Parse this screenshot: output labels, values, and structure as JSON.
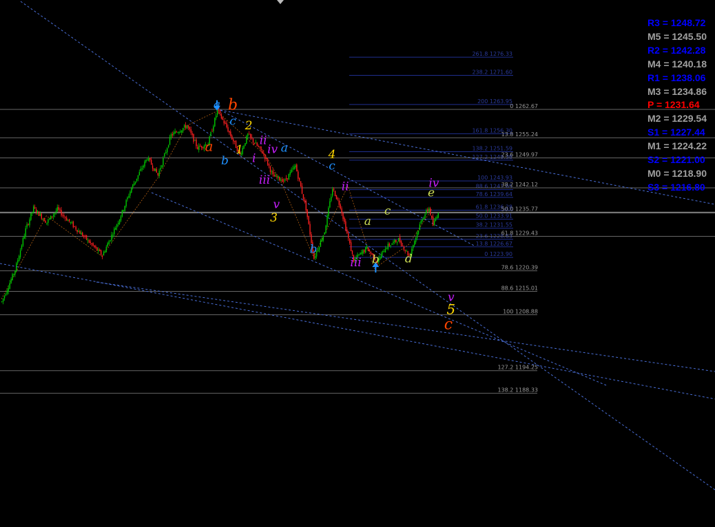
{
  "chart_data": {
    "type": "candlestick",
    "title": "",
    "price_range": [
      1180.0,
      1280.0
    ],
    "colors": {
      "bull": "#00c800",
      "bear": "#ff2020",
      "grid": "#8a8a8a",
      "trend": "#4a6fd8",
      "fib": "#1f2f8f"
    },
    "pivots": [
      {
        "label": "R3 = 1248.72",
        "color": "#0000ff"
      },
      {
        "label": "M5 = 1245.50",
        "color": "#a0a0a0"
      },
      {
        "label": "R2 = 1242.28",
        "color": "#0000ff"
      },
      {
        "label": "M4 = 1240.18",
        "color": "#a0a0a0"
      },
      {
        "label": "R1 = 1238.06",
        "color": "#0000ff"
      },
      {
        "label": "M3 = 1234.86",
        "color": "#a0a0a0"
      },
      {
        "label": "P   = 1231.64",
        "color": "#ff0000"
      },
      {
        "label": "M2 = 1229.54",
        "color": "#a0a0a0"
      },
      {
        "label": "S1 = 1227.44",
        "color": "#0000ff"
      },
      {
        "label": "M1 = 1224.22",
        "color": "#a0a0a0"
      },
      {
        "label": "S2 = 1221.00",
        "color": "#0000ff"
      },
      {
        "label": "M0 = 1218.90",
        "color": "#a0a0a0"
      },
      {
        "label": "S3 = 1216.80",
        "color": "#0000ff"
      }
    ],
    "fib_upper": [
      {
        "label": "261.8 1276.33",
        "price": 1276.33
      },
      {
        "label": "238.2 1271.60",
        "price": 1271.6
      },
      {
        "label": "200 1263.95",
        "price": 1263.95
      },
      {
        "label": "161.8 1256.30",
        "price": 1256.3
      },
      {
        "label": "138.2 1251.59",
        "price": 1251.59
      },
      {
        "label": "127.2 1249.38",
        "price": 1249.38
      },
      {
        "label": "100 1243.93",
        "price": 1243.93
      },
      {
        "label": "88.6 1241.65",
        "price": 1241.65
      },
      {
        "label": "78.6 1239.64",
        "price": 1239.64
      },
      {
        "label": "61.8 1236.28",
        "price": 1236.28
      },
      {
        "label": "50.0 1233.91",
        "price": 1233.91
      },
      {
        "label": "38.2 1231.55",
        "price": 1231.55
      },
      {
        "label": "23.6 1228.63",
        "price": 1228.63
      },
      {
        "label": "13.8 1226.67",
        "price": 1226.67
      },
      {
        "label": "0 1223.90",
        "price": 1223.9
      }
    ],
    "fib_lower": [
      {
        "label": "0 1262.67",
        "price": 1262.67
      },
      {
        "label": "13.8 1255.24",
        "price": 1255.24
      },
      {
        "label": "23.6 1249.97",
        "price": 1249.97
      },
      {
        "label": "38.2 1242.12",
        "price": 1242.12
      },
      {
        "label": "50.0 1235.77",
        "price": 1235.77
      },
      {
        "label": "61.8 1229.43",
        "price": 1229.43
      },
      {
        "label": "78.6 1220.39",
        "price": 1220.39
      },
      {
        "label": "88.6 1215.01",
        "price": 1215.01
      },
      {
        "label": "100 1208.88",
        "price": 1208.88
      },
      {
        "label": "127.2 1194.25",
        "price": 1194.25
      },
      {
        "label": "138.2 1188.33",
        "price": 1188.33
      }
    ],
    "current_price": 1235.6,
    "wave_labels": [
      {
        "text": "a",
        "color": "#1e90ff",
        "bar": 163,
        "price": 1262.9
      },
      {
        "text": "b",
        "color": "#ff4500",
        "bar": 175,
        "price": 1262.6,
        "size": 22
      },
      {
        "text": "c",
        "color": "#1e90ff",
        "bar": 175,
        "price": 1258.6
      },
      {
        "text": "2",
        "color": "#ffd700",
        "bar": 187,
        "price": 1257.4
      },
      {
        "text": "a",
        "color": "#ff4500",
        "bar": 157,
        "price": 1251.8,
        "size": 20
      },
      {
        "text": "1",
        "color": "#ffd700",
        "bar": 180,
        "price": 1251.1
      },
      {
        "text": "ii",
        "color": "#c81eff",
        "bar": 198,
        "price": 1253.6
      },
      {
        "text": "iv",
        "color": "#c81eff",
        "bar": 205,
        "price": 1251.2
      },
      {
        "text": "a",
        "color": "#1e90ff",
        "bar": 214,
        "price": 1251.6
      },
      {
        "text": "b",
        "color": "#1e90ff",
        "bar": 169,
        "price": 1248.3
      },
      {
        "text": "i",
        "color": "#c81eff",
        "bar": 191,
        "price": 1248.9
      },
      {
        "text": "iii",
        "color": "#c81eff",
        "bar": 199,
        "price": 1243.2
      },
      {
        "text": "4",
        "color": "#ffd700",
        "bar": 250,
        "price": 1249.9
      },
      {
        "text": "c",
        "color": "#1e90ff",
        "bar": 250,
        "price": 1246.9
      },
      {
        "text": "ii",
        "color": "#c81eff",
        "bar": 260,
        "price": 1241.5
      },
      {
        "text": "v",
        "color": "#c81eff",
        "bar": 208,
        "price": 1236.8
      },
      {
        "text": "3",
        "color": "#ffd700",
        "bar": 206,
        "price": 1233.3
      },
      {
        "text": "b",
        "color": "#1e90ff",
        "bar": 236,
        "price": 1225.1
      },
      {
        "text": "a",
        "color": "#ccdd55",
        "bar": 277,
        "price": 1232.4
      },
      {
        "text": "c",
        "color": "#ccdd55",
        "bar": 292,
        "price": 1235.1
      },
      {
        "text": "iii",
        "color": "#c81eff",
        "bar": 268,
        "price": 1221.6
      },
      {
        "text": "b",
        "color": "#ccdd55",
        "bar": 283,
        "price": 1222.4
      },
      {
        "text": "d",
        "color": "#ccdd55",
        "bar": 308,
        "price": 1222.6
      },
      {
        "text": "iv",
        "color": "#c81eff",
        "bar": 327,
        "price": 1242.4
      },
      {
        "text": "e",
        "color": "#ccdd55",
        "bar": 325,
        "price": 1239.9
      },
      {
        "text": "v",
        "color": "#c81eff",
        "bar": 340,
        "price": 1212.5
      },
      {
        "text": "5",
        "color": "#ffd700",
        "bar": 340,
        "price": 1209.1,
        "size": 20
      },
      {
        "text": "c",
        "color": "#ff4500",
        "bar": 338,
        "price": 1205.1,
        "size": 22
      }
    ]
  }
}
